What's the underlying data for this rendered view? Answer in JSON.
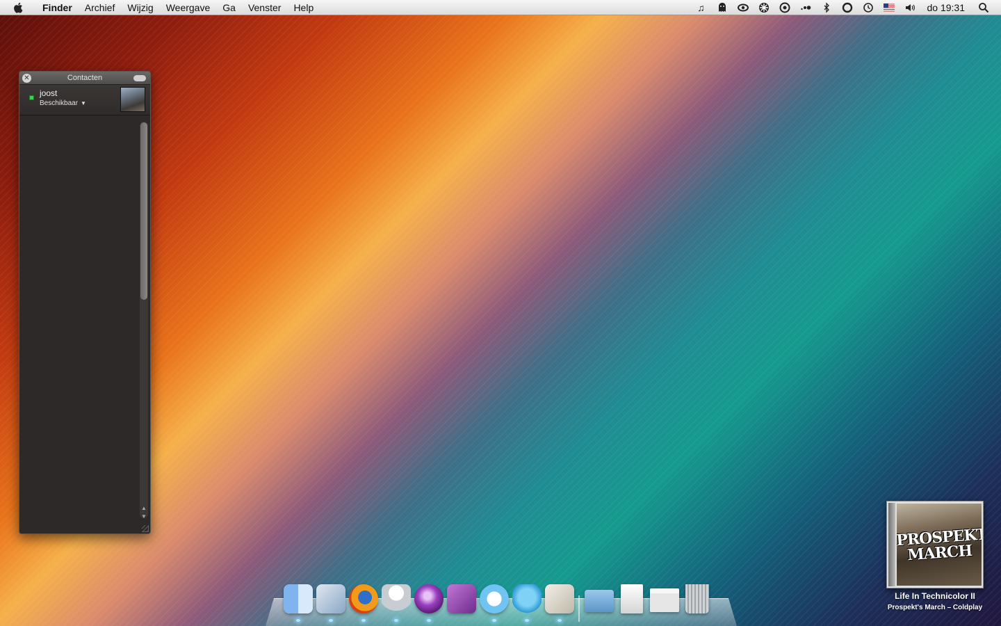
{
  "menubar": {
    "app_name": "Finder",
    "items": [
      "Archief",
      "Wijzig",
      "Weergave",
      "Ga",
      "Venster",
      "Help"
    ],
    "status_icons": [
      "music-note-icon",
      "ghost-icon",
      "eye-icon",
      "settings-wheel-icon",
      "quicksilver-icon",
      "dots-icon",
      "bluetooth-icon",
      "sync-circle-icon",
      "time-machine-icon",
      "us-flag-icon",
      "volume-icon"
    ],
    "clock": "do 19:31"
  },
  "contacts": {
    "title": "Contacten",
    "me": {
      "name": "joost",
      "status": "Beschikbaar",
      "status_color": "#36d44b"
    }
  },
  "now_playing": {
    "art_text": "PROSPEKT'S MARCH",
    "title": "Life In Technicolor II",
    "subtitle": "Prospekt's March – Coldplay"
  },
  "dock": {
    "apps": [
      {
        "name": "finder",
        "icon": "finder-icon",
        "running": true
      },
      {
        "name": "mail",
        "icon": "mail-stamp-icon",
        "running": true
      },
      {
        "name": "firefox",
        "icon": "firefox-icon",
        "running": true
      },
      {
        "name": "robot",
        "icon": "robot-icon",
        "running": true
      },
      {
        "name": "adium",
        "icon": "adium-icon",
        "running": true
      },
      {
        "name": "textmate",
        "icon": "textmate-icon",
        "running": false
      },
      {
        "name": "itunes",
        "icon": "itunes-icon",
        "running": true
      },
      {
        "name": "twitter",
        "icon": "twitter-bird-icon",
        "running": true
      },
      {
        "name": "preview",
        "icon": "preview-icon",
        "running": true
      }
    ],
    "stacks": [
      {
        "name": "folder",
        "icon": "folder-icon"
      },
      {
        "name": "documents",
        "icon": "document-icon"
      },
      {
        "name": "window",
        "icon": "window-icon"
      },
      {
        "name": "trash",
        "icon": "trash-icon"
      }
    ]
  }
}
